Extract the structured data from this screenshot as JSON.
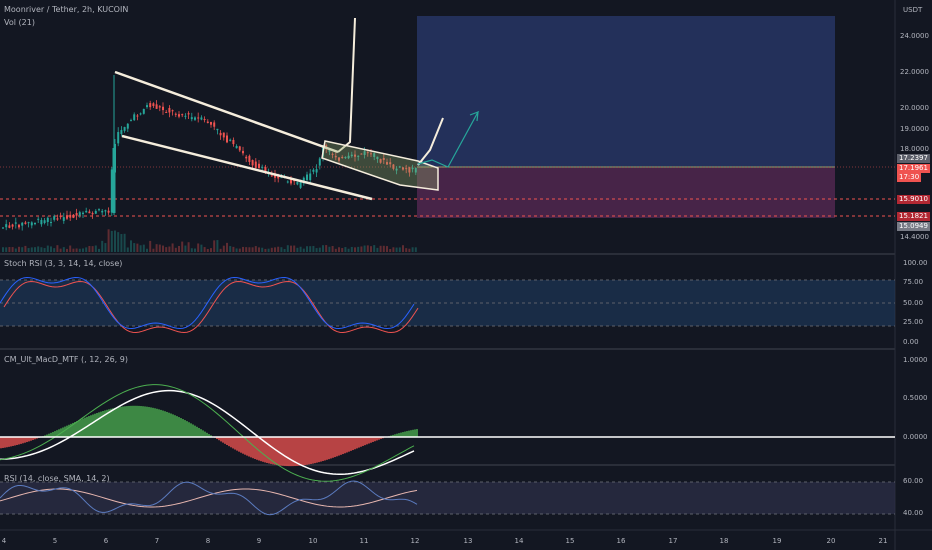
{
  "header": {
    "symbol_title": "Moonriver / Tether, 2h, KUCOIN",
    "volume_label": "Vol (21)",
    "currency": "USDT"
  },
  "price_axis": [
    "24.0000",
    "22.0000",
    "20.0000",
    "19.0000",
    "18.0000",
    "14.4000"
  ],
  "price_tags": {
    "last": "17.2397",
    "current": "17.1961",
    "countdown": "17:30",
    "stop1": "15.9010",
    "stop2": "15.1821",
    "low": "15.0949"
  },
  "indicators": {
    "stoch_rsi": {
      "label": "Stoch RSI (3, 3, 14, 14, close)",
      "levels": [
        "100.00",
        "75.00",
        "50.00",
        "25.00",
        "0.00"
      ]
    },
    "macd": {
      "label": "CM_Ult_MacD_MTF (, 12, 26, 9)",
      "levels": [
        "1.0000",
        "0.5000",
        "0.0000"
      ]
    },
    "rsi": {
      "label": "RSI (14, close, SMA, 14, 2)",
      "levels": [
        "60.00",
        "40.00"
      ]
    }
  },
  "time_axis": [
    "4",
    "5",
    "6",
    "7",
    "8",
    "9",
    "10",
    "11",
    "12",
    "13",
    "14",
    "15",
    "16",
    "17",
    "18",
    "19",
    "20",
    "21"
  ],
  "colors": {
    "background": "#131722",
    "up": "#26a69a",
    "down": "#ef5350",
    "pattern": "#f5eddc",
    "target_zone": "#2a3a6e",
    "stop_zone": "#5a2a55",
    "rsi_zone": "#2a2d45"
  }
}
